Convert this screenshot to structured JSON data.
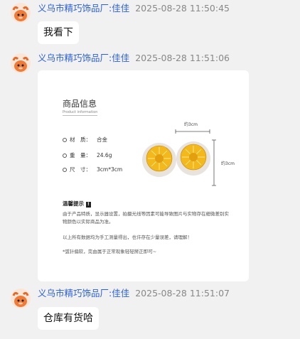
{
  "messages": [
    {
      "sender": "义乌市精巧饰品厂:佳佳",
      "time": "2025-08-28 11:50:45",
      "text": "我看下"
    },
    {
      "sender": "义乌市精巧饰品厂:佳佳",
      "time": "2025-08-28 11:51:06"
    },
    {
      "sender": "义乌市精巧饰品厂:佳佳",
      "time": "2025-08-28 11:51:07",
      "text": "仓库有货哈"
    }
  ],
  "product_card": {
    "title": "商品信息",
    "subtitle": "Product information",
    "specs": [
      {
        "label": "材　质：",
        "value": "合金"
      },
      {
        "label": "重　量：",
        "value": "24.6g"
      },
      {
        "label": "尺　寸：",
        "value": "3cm*3cm"
      }
    ],
    "dim_width": "约3cm",
    "dim_height": "约3cm",
    "notice_title": "温馨提示",
    "notice_mark": "!",
    "notes": [
      "由于产品特质，显示器设置，拍摄光线等因素可能导致图片与实物存在细微差别实物颜色以实际商品为准。",
      "以上所有数据均为手工测量得出，也许存在少量误差，请理解！",
      "*弧针偏软，完由属于正常现象轻轻掰正即可~"
    ]
  },
  "colors": {
    "sender": "#2b5fd8",
    "time": "#888888",
    "background": "#f1f1f1",
    "gold": "#f2b81c"
  }
}
